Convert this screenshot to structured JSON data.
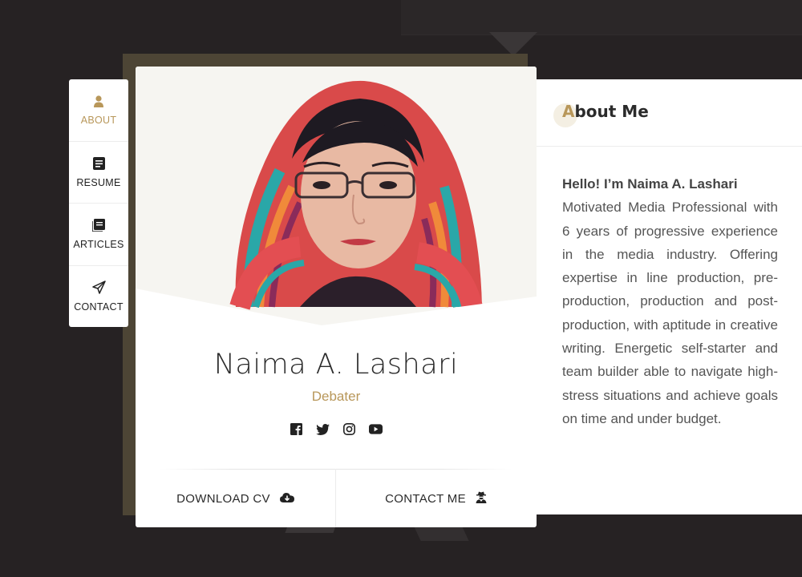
{
  "nav": {
    "items": [
      {
        "label": "ABOUT",
        "icon": "person-icon",
        "active": true
      },
      {
        "label": "RESUME",
        "icon": "document-icon",
        "active": false
      },
      {
        "label": "ARTICLES",
        "icon": "book-icon",
        "active": false
      },
      {
        "label": "CONTACT",
        "icon": "paper-plane-icon",
        "active": false
      }
    ]
  },
  "profile": {
    "name": "Naima A. Lashari",
    "role": "Debater",
    "socials": [
      "facebook-icon",
      "twitter-icon",
      "instagram-icon",
      "youtube-icon"
    ],
    "download_label": "DOWNLOAD CV",
    "contact_label": "CONTACT ME"
  },
  "about": {
    "title_first": "A",
    "title_rest": "bout Me",
    "hello": "Hello! I’m Naima A. Lashari",
    "text": "Motivated Media Professional with 6 years of progressive experience in the media industry. Offering expertise in line production, pre-production, production and post-production, with aptitude in creative writing. Energetic self-starter and team builder able to navigate high-stress situations and achieve goals on time and under budget."
  },
  "colors": {
    "accent": "#b8975a",
    "background": "#262223",
    "card": "#ffffff"
  }
}
